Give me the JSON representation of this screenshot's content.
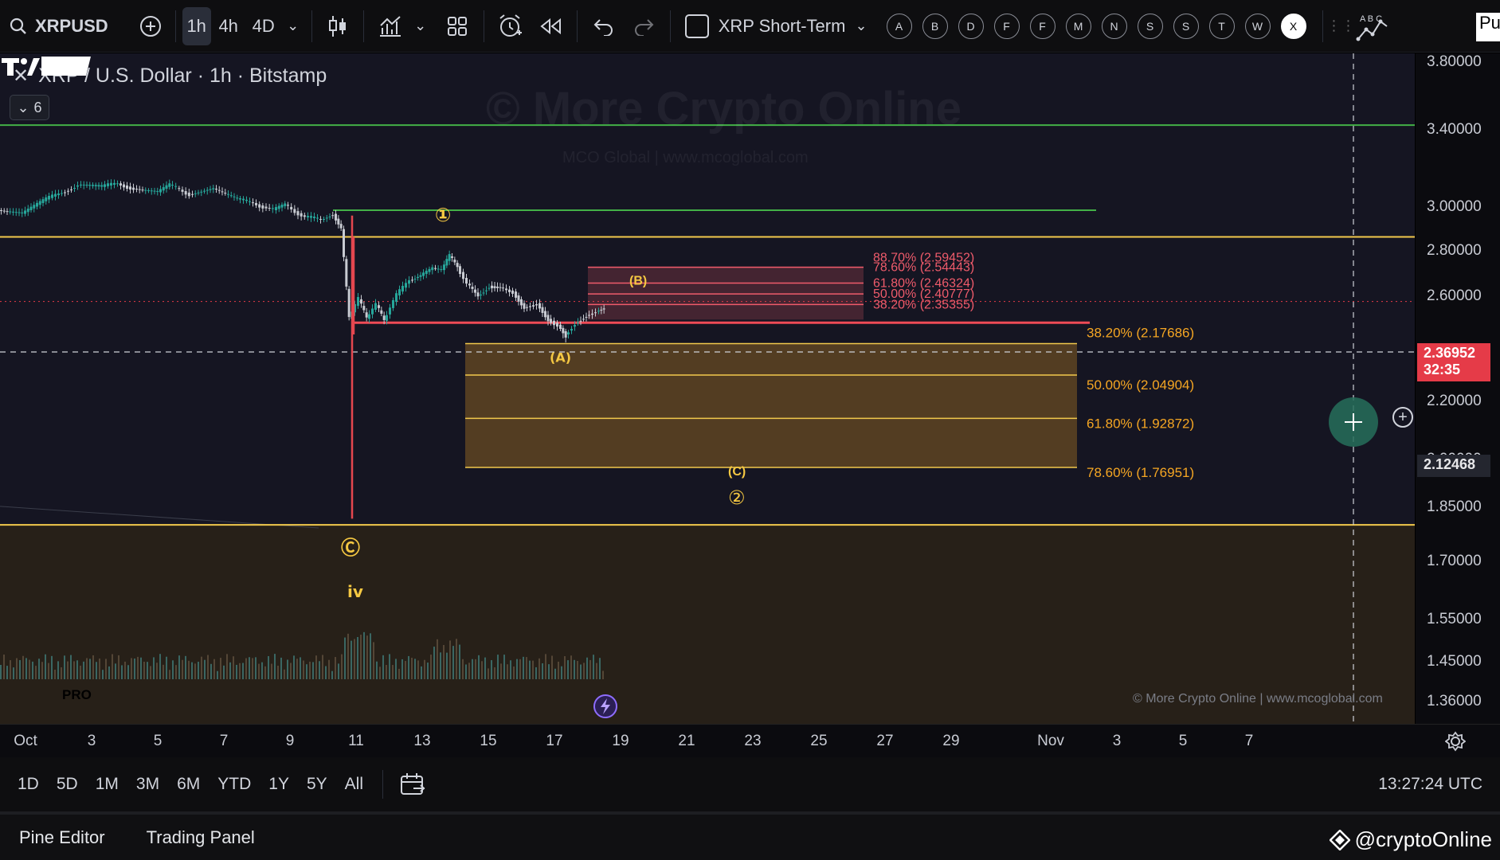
{
  "toolbar": {
    "symbol": "XRPUSD",
    "timeframes": [
      "1h",
      "4h",
      "4D"
    ],
    "active_timeframe": "1h",
    "layout_name": "XRP Short-Term",
    "letters": [
      "A",
      "B",
      "D",
      "F",
      "F",
      "M",
      "N",
      "S",
      "S",
      "T",
      "W",
      "X"
    ],
    "active_letter": "X",
    "cut_off_text": "Pu"
  },
  "legend": {
    "title": "XRP / U.S. Dollar · 1h · Bitstamp",
    "collapse_count": "6"
  },
  "watermark": {
    "big": "© More Crypto Online",
    "small": "MCO Global   |   www.mcoglobal.com",
    "copyright": "© More Crypto Online   |   www.mcoglobal.com",
    "logo_badge": "PRO"
  },
  "price_axis": {
    "labels": [
      "3.80000",
      "3.40000",
      "3.00000",
      "2.80000",
      "2.60000",
      "2.20000",
      "2.00000",
      "1.85000",
      "1.70000",
      "1.55000",
      "1.45000",
      "1.36000"
    ],
    "current_price": "2.36952",
    "countdown": "32:35",
    "crosshair_price": "2.12468"
  },
  "time_axis": {
    "labels": [
      "Oct",
      "3",
      "5",
      "7",
      "9",
      "11",
      "13",
      "15",
      "17",
      "19",
      "21",
      "23",
      "25",
      "27",
      "29",
      "Nov",
      "3",
      "5",
      "7"
    ]
  },
  "range_bar": {
    "ranges": [
      "1D",
      "5D",
      "1M",
      "3M",
      "6M",
      "YTD",
      "1Y",
      "5Y",
      "All"
    ],
    "clock": "13:27:24 UTC"
  },
  "bottom_panel": {
    "tabs": [
      "Pine Editor",
      "Trading Panel"
    ],
    "brand": "@cryptoOnline"
  },
  "chart_data": {
    "type": "candlestick",
    "symbol": "XRPUSD",
    "interval": "1h",
    "exchange": "Bitstamp",
    "x_range": [
      "Oct 1",
      "Nov 7"
    ],
    "y_range": [
      1.36,
      3.8
    ],
    "horizontal_levels": [
      {
        "price": 3.35,
        "color": "#43b047"
      },
      {
        "price": 2.84,
        "color": "#43b047"
      },
      {
        "price": 2.7,
        "color": "#f2c94c"
      },
      {
        "price": 2.26,
        "color": "#ef4b56"
      },
      {
        "price": 1.56,
        "color": "#f2c94c"
      }
    ],
    "fib_b_zone": {
      "label": "(B)",
      "levels": [
        {
          "text": "88.70% (2.59452)",
          "price": 2.59452
        },
        {
          "text": "78.60% (2.54443)",
          "price": 2.54443
        },
        {
          "text": "61.80% (2.46324)",
          "price": 2.46324
        },
        {
          "text": "50.00% (2.40777)",
          "price": 2.40777
        },
        {
          "text": "38.20% (2.35355)",
          "price": 2.35355
        }
      ],
      "color": "#ef5b6b"
    },
    "fib_c_zone": {
      "labels": [
        "(C)",
        "②"
      ],
      "levels": [
        {
          "text": "38.20% (2.17686)",
          "price": 2.17686
        },
        {
          "text": "50.00% (2.04904)",
          "price": 2.04904
        },
        {
          "text": "61.80% (1.92872)",
          "price": 1.92872
        },
        {
          "text": "78.60% (1.76951)",
          "price": 1.76951
        }
      ],
      "color": "#f5a623"
    },
    "wave_labels": [
      {
        "text": "①",
        "date": "Oct 13",
        "price": 2.76
      },
      {
        "text": "(A)",
        "date": "Oct 17",
        "price": 2.1
      },
      {
        "text": "Ⓒ",
        "date": "Oct 11",
        "price": 1.5
      },
      {
        "text": "iv",
        "date": "Oct 11",
        "price": 1.4
      }
    ]
  }
}
